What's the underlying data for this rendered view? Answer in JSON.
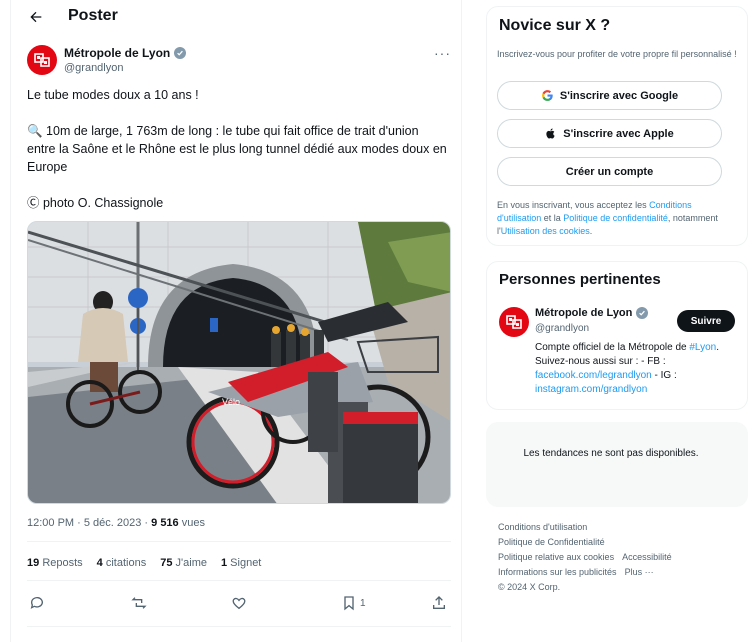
{
  "header": {
    "title": "Poster"
  },
  "tweet": {
    "author_name": "Métropole de Lyon",
    "author_handle": "@grandlyon",
    "text_line1": "Le tube modes doux a 10 ans !",
    "text_line2": "🔍 10m de large, 1 763m de long : le tube qui fait office de trait d'union entre la Saône et le Rhône est le plus long tunnel dédié aux modes doux en Europe",
    "text_line3": "Ⓒ photo O. Chassignole",
    "timestamp": "12:00 PM · 5 déc. 2023 ·",
    "views_count": "9 516",
    "views_label": "vues",
    "photo_bike_brand": "Vélo"
  },
  "stats": {
    "reposts_count": "19",
    "reposts_label": "Reposts",
    "quotes_count": "4",
    "quotes_label": "citations",
    "likes_count": "75",
    "likes_label": "J'aime",
    "bookmarks_count": "1",
    "bookmarks_label": "Signet"
  },
  "actions": {
    "bookmark_count": "1"
  },
  "signup": {
    "title": "Novice sur X ?",
    "subtitle": "Inscrivez-vous pour profiter de votre propre fil personnalisé !",
    "google_label": "S'inscrire avec Google",
    "apple_label": "S'inscrire avec Apple",
    "create_label": "Créer un compte",
    "terms_prefix": "En vous inscrivant, vous acceptez les ",
    "terms_link": "Conditions d'utilisation",
    "terms_mid": " et la ",
    "privacy_link": "Politique de confidentialité",
    "terms_mid2": ", notamment l'",
    "cookies_link": "Utilisation des cookies",
    "terms_end": "."
  },
  "people": {
    "title": "Personnes pertinentes",
    "name": "Métropole de Lyon",
    "handle": "@grandlyon",
    "follow_label": "Suivre",
    "bio_part1": "Compte officiel de la Métropole de ",
    "bio_link1": "#Lyon",
    "bio_part2": ". Suivez-nous aussi sur : - FB : ",
    "bio_link2": "facebook.com/legrandlyon",
    "bio_part3": " - IG : ",
    "bio_link3": "instagram.com/grandlyon"
  },
  "trends": {
    "text": "Les tendances ne sont pas disponibles."
  },
  "footer": {
    "links": [
      "Conditions d'utilisation",
      "Politique de Confidentialité",
      "Politique relative aux cookies",
      "Accessibilité",
      "Informations sur les publicités",
      "Plus ···"
    ],
    "copyright": "© 2024 X Corp."
  },
  "colors": {
    "brand_red": "#e30613",
    "link_blue": "#1d9bf0",
    "text": "#0f1419",
    "muted": "#536471"
  }
}
